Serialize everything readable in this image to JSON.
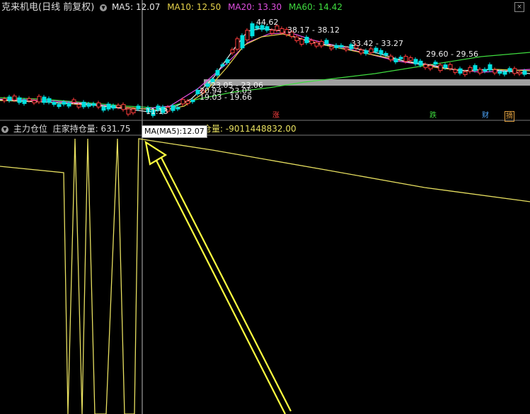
{
  "price_panel": {
    "title": "克来机电(日线 前复权)",
    "ma": [
      {
        "key": "ma5",
        "label": "MA5: 12.07",
        "color": "#e8e8e8"
      },
      {
        "key": "ma10",
        "label": "MA10: 12.50",
        "color": "#e6d24a"
      },
      {
        "key": "ma20",
        "label": "MA20: 13.30",
        "color": "#e04fe0"
      },
      {
        "key": "ma60",
        "label": "MA60: 14.42",
        "color": "#3fdc3f"
      }
    ],
    "settings_icon": "chevron-circle-icon",
    "peak_label": "44.62",
    "range_labels": [
      "38.17 - 38.12",
      "33.42 - 33.27",
      "29.60 - 29.56",
      "23.05 - 23.06",
      "20.94 - 23.05",
      "19.03 - 19.66"
    ],
    "low_label": "11.13",
    "event_tags": [
      {
        "text": "涨",
        "color": "#ff4040"
      },
      {
        "text": "跌",
        "color": "#3fdc3f"
      },
      {
        "text": "财",
        "color": "#4fa8ff"
      },
      {
        "text": "摘",
        "color": "#e0a040"
      }
    ]
  },
  "indicator_panel": {
    "title": "主力仓位",
    "line1_label": "庄家持仓量: 631.75",
    "line2_label": "仓量: -9011448832.00",
    "tooltip": "MA(MA5):12.07"
  },
  "colors": {
    "up": "#ff3b3b",
    "down": "#00e0e0",
    "indicator": "#e8e060",
    "arrow": "#ffff40",
    "grid": "#666"
  }
}
